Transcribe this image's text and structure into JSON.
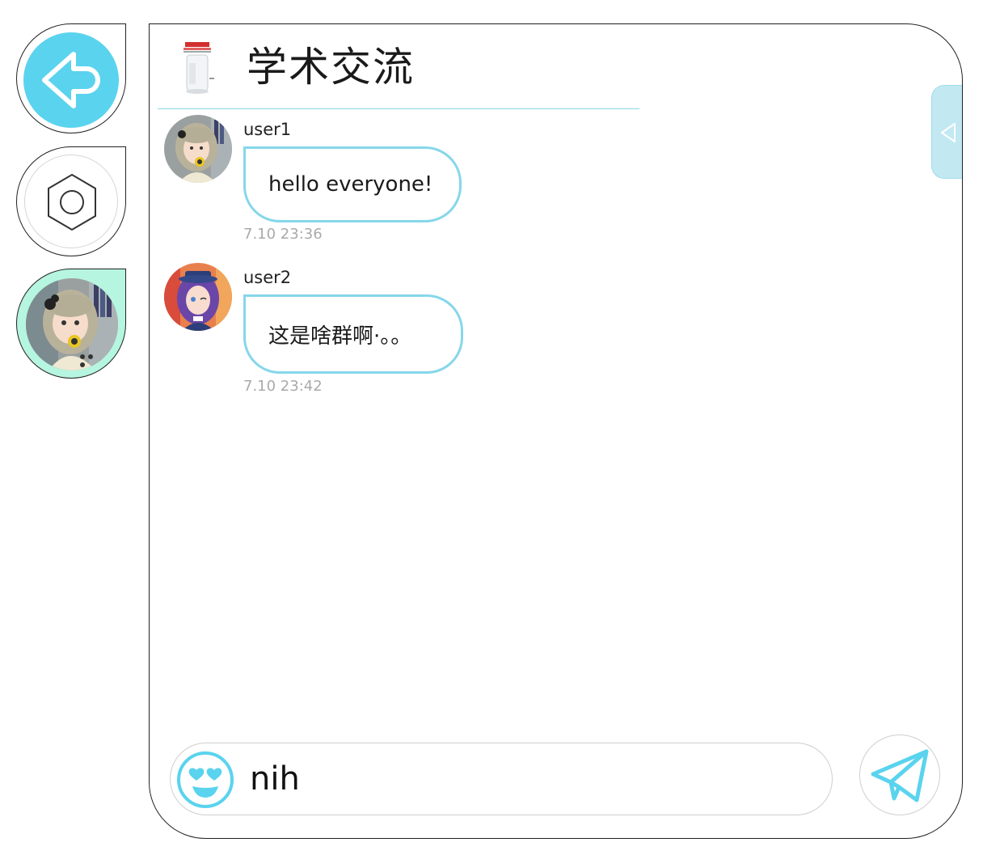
{
  "nav": {
    "back_icon": "arrow-left-icon",
    "settings_icon": "hexagon-nut-icon",
    "profile_avatar": "avatar-image",
    "accent_color": "#5ad3ee",
    "profile_bg_color": "#b6f5e0"
  },
  "group": {
    "title": "学术交流",
    "logo": "group-logo-image",
    "header_line_color": "#8fd6ea"
  },
  "side_toggle": {
    "icon": "triangle-left-icon",
    "color": "#c2e9f2"
  },
  "messages": [
    {
      "username": "user1",
      "text": "hello everyone!",
      "time": "7.10 23:36",
      "avatar": "avatar-image"
    },
    {
      "username": "user2",
      "text": "这是啥群啊·。。",
      "time": "7.10 23:42",
      "avatar": "avatar-image"
    }
  ],
  "composer": {
    "value": "nih",
    "emoji_icon": "heart-eyes-emoji-icon",
    "send_icon": "paper-plane-icon",
    "bubble_border_color": "#86d7ea"
  }
}
